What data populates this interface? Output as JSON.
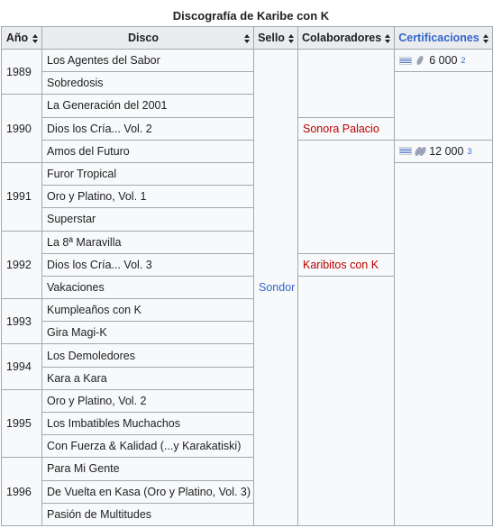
{
  "caption": "Discografía de Karibe con K",
  "headers": {
    "year": "Año",
    "album": "Disco",
    "label": "Sello",
    "collab": "Colaboradores",
    "cert": "Certificaciones"
  },
  "years": [
    "1989",
    "1990",
    "1991",
    "1992",
    "1993",
    "1994",
    "1995",
    "1996"
  ],
  "albums": [
    "Los Agentes del Sabor",
    "Sobredosis",
    "La Generación del 2001",
    "Dios los Cría... Vol. 2",
    "Amos del Futuro",
    "Furor Tropical",
    "Oro y Platino, Vol. 1",
    "Superstar",
    "La 8ª Maravilla",
    "Dios los Cría... Vol. 3",
    "Vakaciones",
    "Kumpleaños con K",
    "Gira Magi-K",
    "Los Demoledores",
    "Kara a Kara",
    "Oro y Platino, Vol. 2",
    "Los Imbatibles Muchachos",
    "Con Fuerza & Kalidad (...y Karakatiski)",
    "Para Mi Gente",
    "De Vuelta en Kasa (Oro y Platino, Vol. 3)",
    "Pasión de Multitudes"
  ],
  "label": "Sondor",
  "collaborators": [
    "Sonora Palacio",
    "Karibitos con K"
  ],
  "certifications": [
    {
      "flag": "uruguay-flag-icon",
      "award": "platinum-disc-icon",
      "count": "6 000",
      "ref": "2"
    },
    {
      "flag": "uruguay-flag-icon",
      "award": "double-platinum-disc-icon",
      "count": "12 000",
      "ref": "3"
    }
  ],
  "colors": {
    "link": "#3366cc",
    "redlink": "#ba0000",
    "header_bg": "#eaecf0",
    "cell_bg": "#f8f9fa",
    "border": "#a2a9b1"
  }
}
